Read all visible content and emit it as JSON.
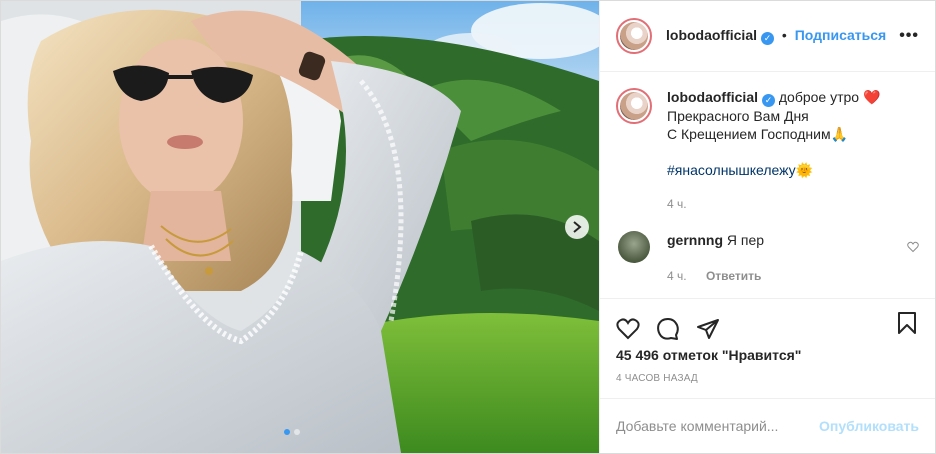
{
  "post": {
    "username": "lobodaofficial",
    "verified_icon": "verified-badge-icon",
    "bullet": "•",
    "follow_label": "Подписаться",
    "more_icon": "more-options-icon",
    "more_label": "•••"
  },
  "caption": {
    "username": "lobodaofficial",
    "lines": [
      "доброе утро ❤️",
      "Прекрасного Вам Дня",
      "С Крещением Господним🙏"
    ],
    "hashtag": "#янасолнышкележу🌞",
    "time": "4 ч."
  },
  "comments": [
    {
      "username": "gernnng",
      "text": "Я пер",
      "time": "4 ч.",
      "reply_label": "Ответить",
      "like_icon": "heart-outline-icon"
    }
  ],
  "actions": {
    "like_icon": "heart-icon",
    "comment_icon": "comment-icon",
    "share_icon": "share-icon",
    "save_icon": "bookmark-icon"
  },
  "likes_text": "45 496 отметок \"Нравится\"",
  "timestamp": "4 часов назад",
  "add_comment": {
    "placeholder": "Добавьте комментарий...",
    "publish_label": "Опубликовать"
  },
  "carousel": {
    "next_icon": "chevron-right-icon",
    "dot_count": 2,
    "active_dot": 1
  },
  "colors": {
    "accent": "#3897f0",
    "publish_disabled": "#b2dffc",
    "muted": "#8e8e8e",
    "hashtag": "#003569"
  }
}
